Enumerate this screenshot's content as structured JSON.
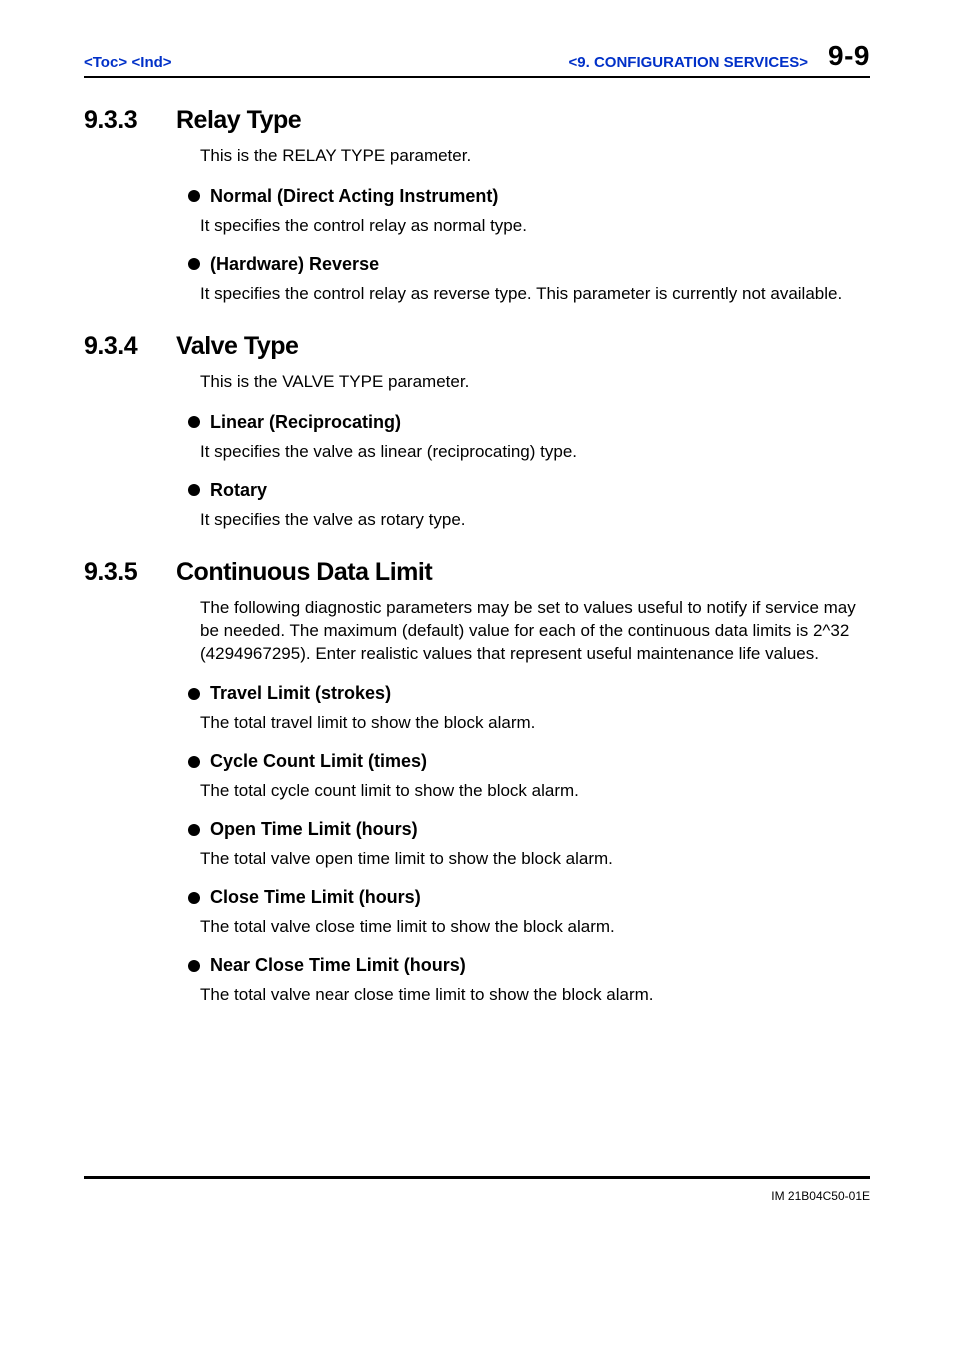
{
  "header": {
    "toc": "<Toc>",
    "ind": "<Ind>",
    "chapter": "<9.  CONFIGURATION SERVICES>",
    "pageNum": "9-9"
  },
  "sections": [
    {
      "num": "9.3.3",
      "title": "Relay Type",
      "intro": "This is the RELAY TYPE parameter.",
      "items": [
        {
          "head": "Normal (Direct Acting Instrument)",
          "body": "It specifies the control relay as normal type."
        },
        {
          "head": "(Hardware) Reverse",
          "body": "It specifies the control relay as reverse type.  This parameter is currently not available."
        }
      ]
    },
    {
      "num": "9.3.4",
      "title": "Valve Type",
      "intro": "This is the VALVE TYPE parameter.",
      "items": [
        {
          "head": "Linear (Reciprocating)",
          "body": "It specifies the valve as linear (reciprocating) type."
        },
        {
          "head": "Rotary",
          "body": "It specifies the valve as rotary type."
        }
      ]
    },
    {
      "num": "9.3.5",
      "title": "Continuous Data Limit",
      "intro": "The following diagnostic parameters may be set to values useful to notify if service may be needed. The maximum (default) value for each of the continuous data limits is 2^32 (4294967295).  Enter realistic values that represent useful maintenance life values.",
      "items": [
        {
          "head": "Travel Limit (strokes)",
          "body": "The total travel limit to show the block alarm."
        },
        {
          "head": "Cycle Count Limit (times)",
          "body": "The total cycle count limit to show the block alarm."
        },
        {
          "head": "Open Time Limit (hours)",
          "body": "The total valve open time limit to show the block alarm."
        },
        {
          "head": "Close Time Limit (hours)",
          "body": "The total valve close time limit to show the block alarm."
        },
        {
          "head": "Near Close Time Limit (hours)",
          "body": "The total valve near close time limit to show the block alarm."
        }
      ]
    }
  ],
  "docId": "IM 21B04C50-01E"
}
